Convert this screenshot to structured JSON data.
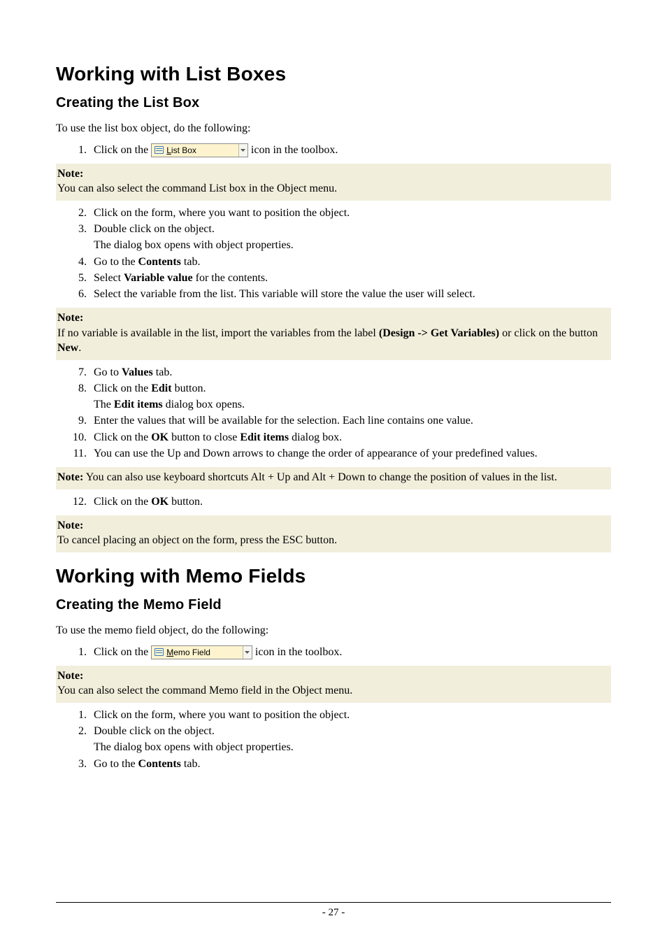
{
  "list_box": {
    "heading": "Working with List Boxes",
    "subheading": "Creating the List Box",
    "intro": "To use the list box object, do the following:",
    "step1_a": "Click on the ",
    "step1_b": " icon in the toolbox.",
    "button": {
      "ico_name": "listbox-icon",
      "mnemonic": "L",
      "rest": "ist Box"
    },
    "note1_label": "Note:",
    "note1_text": "You can also select the command List box  in the Object menu.",
    "step2": "Click on the form, where you want to position the object.",
    "step3": "Double click on the object.",
    "step3b": "The dialog box opens with object properties.",
    "step4_a": "Go to the ",
    "step4_bold": "Contents",
    "step4_b": " tab.",
    "step5_a": "Select ",
    "step5_bold": "Variable value",
    "step5_b": " for the contents.",
    "step6": "Select the variable from the list. This variable will store the value the user will select.",
    "note2_label": "Note:",
    "note2_a": "If no variable is available in the list, import the variables from the label ",
    "note2_bold1": "(Design -> Get Variables)",
    "note2_b": " or click on the button ",
    "note2_bold2": "New",
    "note2_c": ".",
    "step7_a": "Go to ",
    "step7_bold": "Values",
    "step7_b": " tab.",
    "step8_a": "Click on the ",
    "step8_bold": "Edit",
    "step8_b": " button.",
    "step8c_a": "The ",
    "step8c_bold": "Edit items",
    "step8c_b": " dialog box opens.",
    "step9": "Enter the values that will be available for the selection. Each line contains one value.",
    "step10_a": "Click on the ",
    "step10_bold1": "OK",
    "step10_b": " button to close ",
    "step10_bold2": "Edit items",
    "step10_c": " dialog box.",
    "step11": "You can use the Up and Down arrows to change the order of appearance of your predefined values.",
    "note3_bold": "Note:",
    "note3_text": " You can also use keyboard shortcuts Alt + Up and Alt + Down to change the position of values in the list.",
    "step12_a": "Click on the ",
    "step12_bold": "OK",
    "step12_b": " button.",
    "note4_label": "Note:",
    "note4_text": "To cancel placing an object on the form, press the ESC button."
  },
  "memo": {
    "heading": "Working with Memo Fields",
    "subheading": "Creating the Memo Field",
    "intro": "To use the memo field object, do the following:",
    "step1_a": "Click on the ",
    "step1_b": " icon in the toolbox.",
    "button": {
      "ico_name": "memofield-icon",
      "mnemonic": "M",
      "rest": "emo Field"
    },
    "note1_label": "Note:",
    "note1_text": "You can also select the command Memo field in the Object menu.",
    "step1l": "Click on the form, where you want to position the object.",
    "step2l": "Double click on the object.",
    "step2b": "The dialog box opens with object properties.",
    "step3l_a": "Go to the ",
    "step3l_bold": "Contents",
    "step3l_b": " tab."
  },
  "page_number": "- 27 -"
}
